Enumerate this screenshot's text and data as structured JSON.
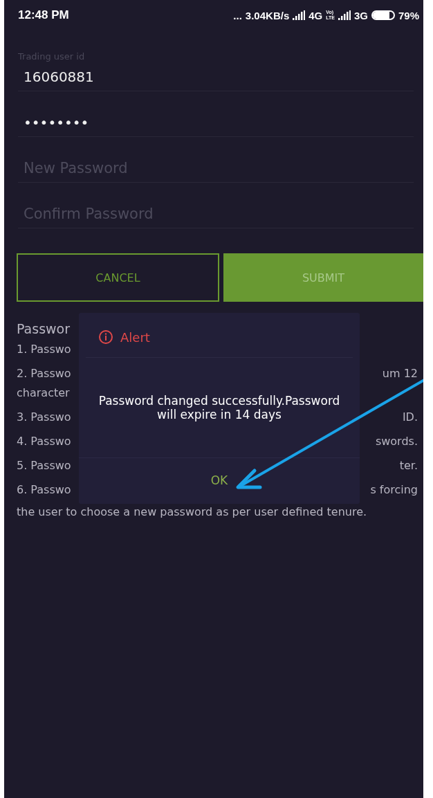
{
  "status_bar": {
    "time": "12:48 PM",
    "dots": "...",
    "speed": "3.04KB/s",
    "network_1": "4G",
    "volte_top": "Vo)",
    "volte_bottom": "LTE",
    "network_2": "3G",
    "battery": {
      "level": 0.79
    },
    "battery_text": "79%"
  },
  "fields": [
    {
      "label": "Trading user id",
      "value": "16060881"
    },
    {
      "value": "••••••••"
    },
    {
      "placeholder": "New Password"
    },
    {
      "placeholder": "Confirm Password"
    }
  ],
  "buttons": [
    {
      "kind": "outline",
      "label": "CANCEL"
    },
    {
      "kind": "filled",
      "label": "SUBMIT"
    }
  ],
  "rules": {
    "heading": "Passwor",
    "lines": [
      {
        "left": "1. Passwo"
      },
      {
        "left": "2. Passwo",
        "right": "um 12"
      },
      {
        "left": "character"
      },
      {
        "left": "3. Passwo",
        "right": "ID."
      },
      {
        "left": "4. Passwo",
        "right": "swords."
      },
      {
        "left": "5. Passwo",
        "right": "ter."
      },
      {
        "left": "6. Passwo",
        "right": "s forcing"
      },
      {
        "left": "the user to choose a new password as per user defined tenure."
      }
    ]
  },
  "dialog": {
    "title": "Alert",
    "message": "Password changed successfully.Password will expire in 14 days",
    "button": "OK"
  }
}
